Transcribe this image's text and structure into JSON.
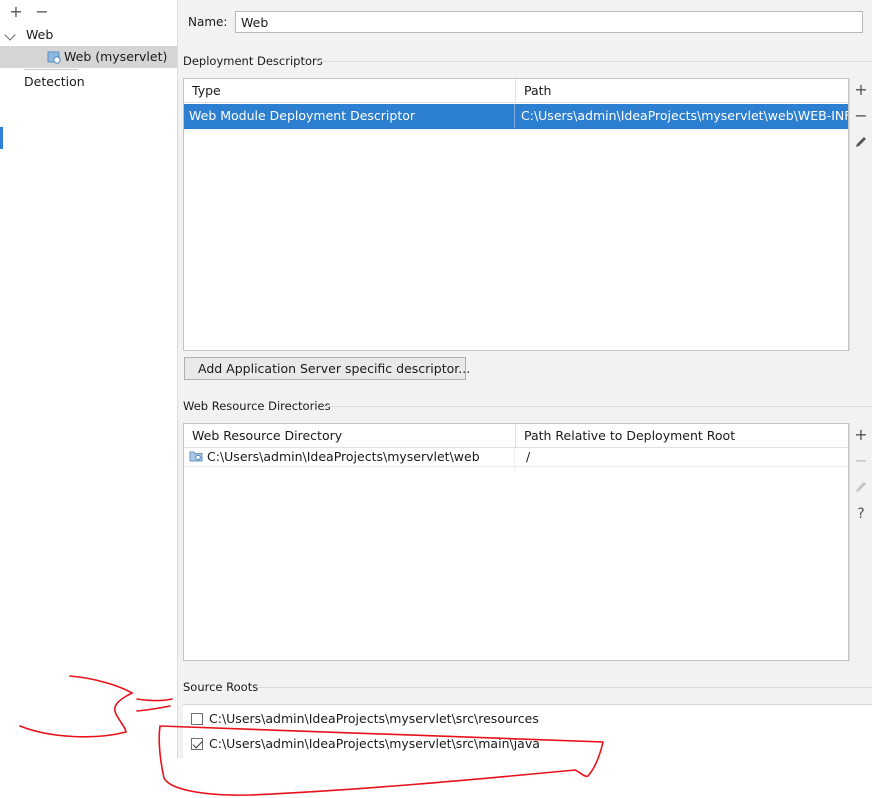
{
  "toolbar": {
    "add": "+",
    "remove": "−"
  },
  "tree": {
    "web_label": "Web",
    "web_child_label": "Web (myservlet)",
    "detection_label": "Detection"
  },
  "name_field": {
    "label": "Name:",
    "value": "Web"
  },
  "deployment_descriptors": {
    "section_title": "Deployment Descriptors",
    "headers": {
      "type": "Type",
      "path": "Path"
    },
    "rows": [
      {
        "type": "Web Module Deployment Descriptor",
        "path": "C:\\Users\\admin\\IdeaProjects\\myservlet\\web\\WEB-INF\\web.xml"
      }
    ],
    "add_server_button": "Add Application Server specific descriptor..."
  },
  "web_resource_directories": {
    "section_title": "Web Resource Directories",
    "headers": {
      "dir": "Web Resource Directory",
      "relative": "Path Relative to Deployment Root"
    },
    "rows": [
      {
        "dir": "C:\\Users\\admin\\IdeaProjects\\myservlet\\web",
        "relative": "/"
      }
    ]
  },
  "side_buttons": {
    "add": "+",
    "remove": "−",
    "edit": "✎",
    "help": "?"
  },
  "source_roots": {
    "section_title": "Source Roots",
    "items": [
      {
        "path": "C:\\Users\\admin\\IdeaProjects\\myservlet\\src\\resources",
        "checked": false
      },
      {
        "path": "C:\\Users\\admin\\IdeaProjects\\myservlet\\src\\main\\java",
        "checked": true
      }
    ]
  },
  "colors": {
    "selection": "#2d7fd1",
    "annotation_ink": "#e8111b"
  }
}
